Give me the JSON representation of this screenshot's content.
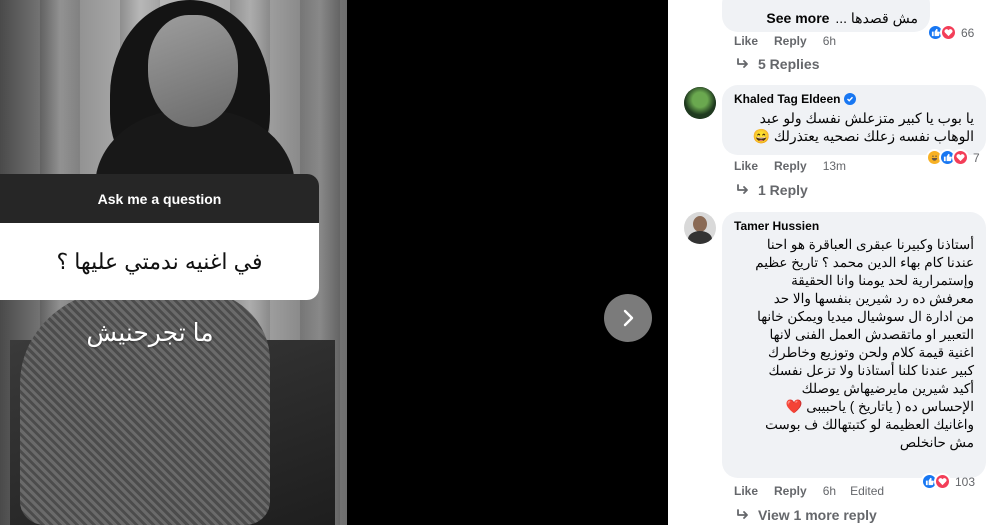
{
  "story": {
    "question_title": "Ask me a question",
    "question_text": "في اغنيه ندمتي عليها ؟",
    "answer_text": "ما تجرحنيش"
  },
  "comments": [
    {
      "body_tail": "مش قصدها ...",
      "see_more": "See more",
      "like": "Like",
      "reply": "Reply",
      "time": "6h",
      "reaction_count": "66",
      "replies_label": "5 Replies"
    },
    {
      "author": "Khaled Tag Eldeen",
      "verified": true,
      "body": "يا بوب يا كبير متزعلش نفسك ولو عبد الوهاب نفسه زعلك نصحيه يعتذرلك 😄",
      "like": "Like",
      "reply": "Reply",
      "time": "13m",
      "reaction_count": "7",
      "replies_label": "1 Reply"
    },
    {
      "author": "Tamer Hussien",
      "body_lines": [
        "أستاذنا وكبيرنا عبقرى العباقرة هو احنا",
        "عندنا كام بهاء الدين محمد ؟ تاريخ عظيم",
        "وإستمرارية لحد يومنا وانا الحقيقة",
        "معرفش ده رد شيرين بنفسها والا حد",
        "من ادارة ال سوشيال ميديا ويمكن خانها",
        "التعبير او ماتقصدش العمل الفنى لانها",
        "اغنية قيمة كلام ولحن وتوزيع وخاطرك",
        "كبير عندنا كلنا أستاذنا ولا تزعل نفسك",
        "أكيد شيرين مايرضيهاش يوصلك",
        "الإحساس ده ( ياتاريخ ) ياحبيبى ❤️",
        "واغانيك العظيمة لو كتبتهالك ف بوست",
        "مش حانخلص"
      ],
      "like": "Like",
      "reply": "Reply",
      "time": "6h",
      "edited": "Edited",
      "reaction_count": "103",
      "replies_label": "View 1 more reply"
    }
  ],
  "icons": {
    "next": "chevron-right-icon",
    "reply_arrow": "reply-arrow-icon",
    "like": "like-icon",
    "love": "love-icon",
    "haha": "haha-icon",
    "verified": "verified-badge-icon"
  },
  "colors": {
    "facebook_blue": "#1877f2",
    "love_red": "#f33e58",
    "meta_gray": "#65676b",
    "bubble_bg": "#f0f2f5"
  }
}
